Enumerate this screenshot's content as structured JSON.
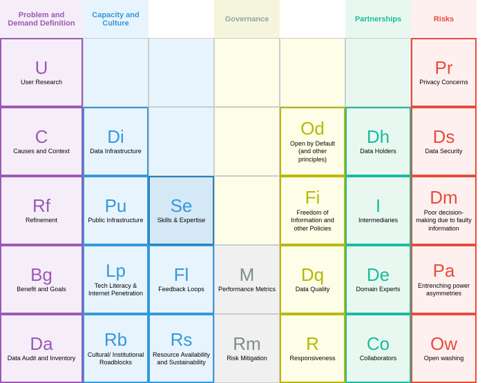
{
  "headers": [
    {
      "id": "problem",
      "label": "Problem and Demand Definition",
      "class": "h-problem"
    },
    {
      "id": "capacity",
      "label": "Capacity and Culture",
      "class": "h-capacity"
    },
    {
      "id": "col3",
      "label": "",
      "class": ""
    },
    {
      "id": "governance",
      "label": "Governance",
      "class": "h-governance"
    },
    {
      "id": "col5",
      "label": "",
      "class": ""
    },
    {
      "id": "partnerships",
      "label": "Partnerships",
      "class": "h-partnerships"
    },
    {
      "id": "risks",
      "label": "Risks",
      "class": "h-risks"
    }
  ],
  "rows": [
    {
      "id": "row1",
      "cells": [
        {
          "symbol": "U",
          "label": "User Research",
          "sym_color": "c-purple",
          "bg": "bg-light-purple",
          "border": "b-purple"
        },
        {
          "symbol": "",
          "label": "",
          "sym_color": "",
          "bg": "bg-light-blue",
          "border": "b-gray-light",
          "empty": true
        },
        {
          "symbol": "",
          "label": "",
          "sym_color": "",
          "bg": "bg-light-blue",
          "border": "b-gray-light",
          "empty": true
        },
        {
          "symbol": "",
          "label": "",
          "sym_color": "",
          "bg": "bg-light-yellow",
          "border": "b-gray-light",
          "empty": true
        },
        {
          "symbol": "",
          "label": "",
          "sym_color": "",
          "bg": "bg-light-yellow",
          "border": "b-gray-light",
          "empty": true
        },
        {
          "symbol": "",
          "label": "",
          "sym_color": "",
          "bg": "bg-light-green",
          "border": "b-gray-light",
          "empty": true
        },
        {
          "symbol": "Pr",
          "label": "Privacy Concerns",
          "sym_color": "c-red",
          "bg": "bg-light-pink",
          "border": "b-red"
        }
      ]
    },
    {
      "id": "row2",
      "cells": [
        {
          "symbol": "C",
          "label": "Causes and Context",
          "sym_color": "c-purple",
          "bg": "bg-light-purple",
          "border": "b-purple"
        },
        {
          "symbol": "Di",
          "label": "Data Infrastructure",
          "sym_color": "c-blue",
          "bg": "bg-light-blue",
          "border": "b-blue"
        },
        {
          "symbol": "",
          "label": "",
          "sym_color": "",
          "bg": "bg-light-blue",
          "border": "b-gray-light",
          "empty": true
        },
        {
          "symbol": "",
          "label": "",
          "sym_color": "",
          "bg": "bg-light-yellow",
          "border": "b-gray-light",
          "empty": true
        },
        {
          "symbol": "Od",
          "label": "Open by Default (and other principles)",
          "sym_color": "c-olive",
          "bg": "bg-light-yellow",
          "border": "b-olive"
        },
        {
          "symbol": "Dh",
          "label": "Data Holders",
          "sym_color": "c-teal",
          "bg": "bg-light-green",
          "border": "b-teal"
        },
        {
          "symbol": "Ds",
          "label": "Data Security",
          "sym_color": "c-red",
          "bg": "bg-light-pink",
          "border": "b-red"
        }
      ]
    },
    {
      "id": "row3",
      "cells": [
        {
          "symbol": "Rf",
          "label": "Refinement",
          "sym_color": "c-purple",
          "bg": "bg-light-purple",
          "border": "b-purple"
        },
        {
          "symbol": "Pu",
          "label": "Public Infrastructure",
          "sym_color": "c-blue",
          "bg": "bg-light-blue",
          "border": "b-blue"
        },
        {
          "symbol": "Se",
          "label": "Skills & Expertise",
          "sym_color": "c-blue",
          "bg": "bg-medium-blue",
          "border": "b-blue-dark"
        },
        {
          "symbol": "",
          "label": "",
          "sym_color": "",
          "bg": "bg-light-yellow",
          "border": "b-gray-light",
          "empty": true
        },
        {
          "symbol": "Fi",
          "label": "Freedom of Information and other Policies",
          "sym_color": "c-olive",
          "bg": "bg-light-yellow",
          "border": "b-olive"
        },
        {
          "symbol": "I",
          "label": "Intermediaries",
          "sym_color": "c-teal",
          "bg": "bg-light-green",
          "border": "b-teal"
        },
        {
          "symbol": "Dm",
          "label": "Poor decision-making due to faulty information",
          "sym_color": "c-red",
          "bg": "bg-light-pink",
          "border": "b-red"
        }
      ]
    },
    {
      "id": "row4",
      "cells": [
        {
          "symbol": "Bg",
          "label": "Benefit and Goals",
          "sym_color": "c-purple",
          "bg": "bg-light-purple",
          "border": "b-purple"
        },
        {
          "symbol": "Lp",
          "label": "Tech Literacy & Internet Penetration",
          "sym_color": "c-blue",
          "bg": "bg-light-blue",
          "border": "b-blue"
        },
        {
          "symbol": "Fl",
          "label": "Feedback Loops",
          "sym_color": "c-blue",
          "bg": "bg-light-blue",
          "border": "b-blue"
        },
        {
          "symbol": "M",
          "label": "Performance Metrics",
          "sym_color": "c-gray",
          "bg": "bg-light-gray",
          "border": "b-gray-light"
        },
        {
          "symbol": "Dq",
          "label": "Data Quality",
          "sym_color": "c-olive",
          "bg": "bg-light-yellow",
          "border": "b-olive"
        },
        {
          "symbol": "De",
          "label": "Domain Experts",
          "sym_color": "c-teal",
          "bg": "bg-light-green",
          "border": "b-teal"
        },
        {
          "symbol": "Pa",
          "label": "Entrenching power asymmetries",
          "sym_color": "c-red",
          "bg": "bg-light-pink",
          "border": "b-red"
        }
      ]
    },
    {
      "id": "row5",
      "cells": [
        {
          "symbol": "Da",
          "label": "Data Audit and Inventory",
          "sym_color": "c-purple",
          "bg": "bg-light-purple",
          "border": "b-purple"
        },
        {
          "symbol": "Rb",
          "label": "Cultural/ Institutional Roadblocks",
          "sym_color": "c-blue",
          "bg": "bg-light-blue",
          "border": "b-blue"
        },
        {
          "symbol": "Rs",
          "label": "Resource Availability and Sustainability",
          "sym_color": "c-blue",
          "bg": "bg-light-blue",
          "border": "b-blue"
        },
        {
          "symbol": "Rm",
          "label": "Risk Mitigation",
          "sym_color": "c-gray",
          "bg": "bg-light-gray",
          "border": "b-gray-light"
        },
        {
          "symbol": "R",
          "label": "Responsiveness",
          "sym_color": "c-olive",
          "bg": "bg-light-yellow",
          "border": "b-olive"
        },
        {
          "symbol": "Co",
          "label": "Collaborators",
          "sym_color": "c-teal",
          "bg": "bg-light-green",
          "border": "b-teal"
        },
        {
          "symbol": "Ow",
          "label": "Open washing",
          "sym_color": "c-red",
          "bg": "bg-light-pink",
          "border": "b-red"
        }
      ]
    }
  ]
}
